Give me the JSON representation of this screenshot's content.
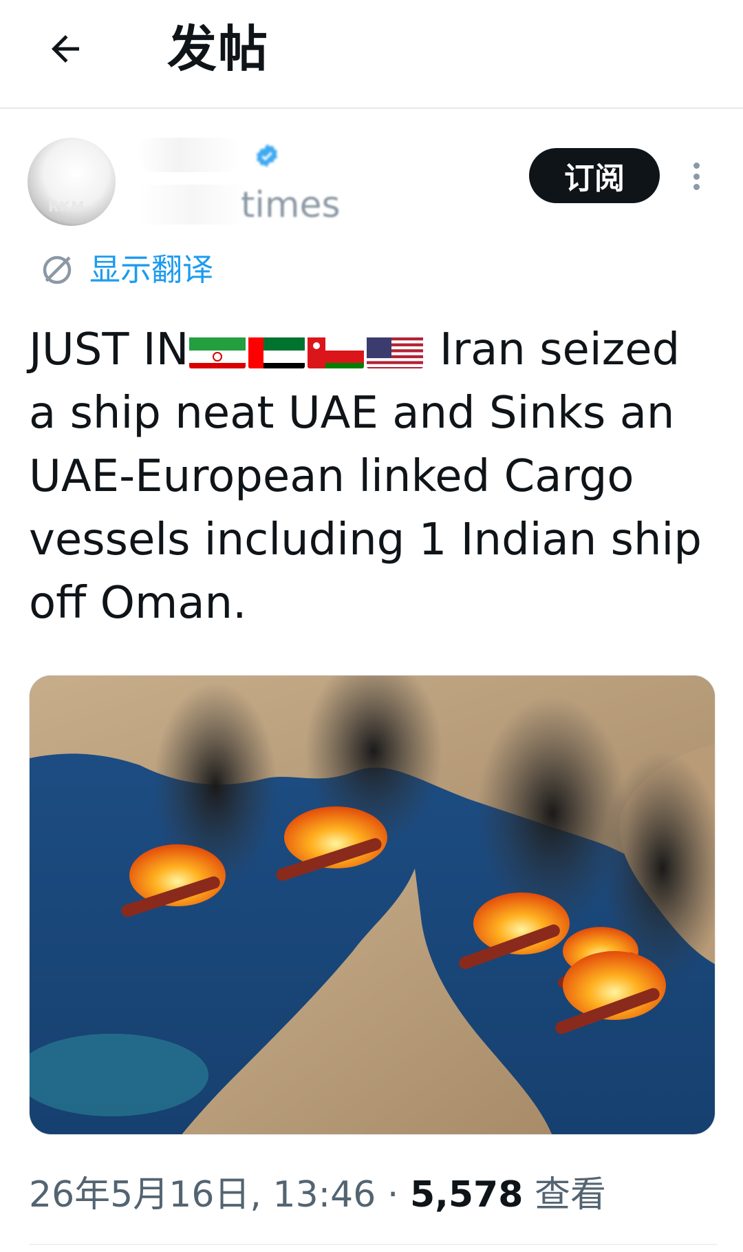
{
  "header": {
    "title": "发帖",
    "back_icon": "arrow-left-icon"
  },
  "author": {
    "avatar_text": "RKM",
    "handle_suffix": "times",
    "verified_icon": "verified-badge-icon",
    "subscribe_label": "订阅",
    "more_icon": "more-vertical-icon"
  },
  "translate": {
    "icon": "translate-icon",
    "label": "显示翻译"
  },
  "tweet": {
    "text_prefix": "JUST IN",
    "flags": [
      "iran-flag-icon",
      "uae-flag-icon",
      "oman-flag-icon",
      "usa-flag-icon"
    ],
    "text_body": " Iran seized a ship neat UAE and Sinks an UAE-European linked Cargo vessels including 1 Indian ship off Oman."
  },
  "media": {
    "description_icon": "burning-ships-image"
  },
  "meta": {
    "timestamp": "26年5月16日, 13:46 · ",
    "views_count": "5,578",
    "views_label": " 查看"
  },
  "colors": {
    "accent": "#1d9bf0",
    "text_primary": "#0f1419",
    "text_secondary": "#536471",
    "button_dark": "#0f1419"
  }
}
